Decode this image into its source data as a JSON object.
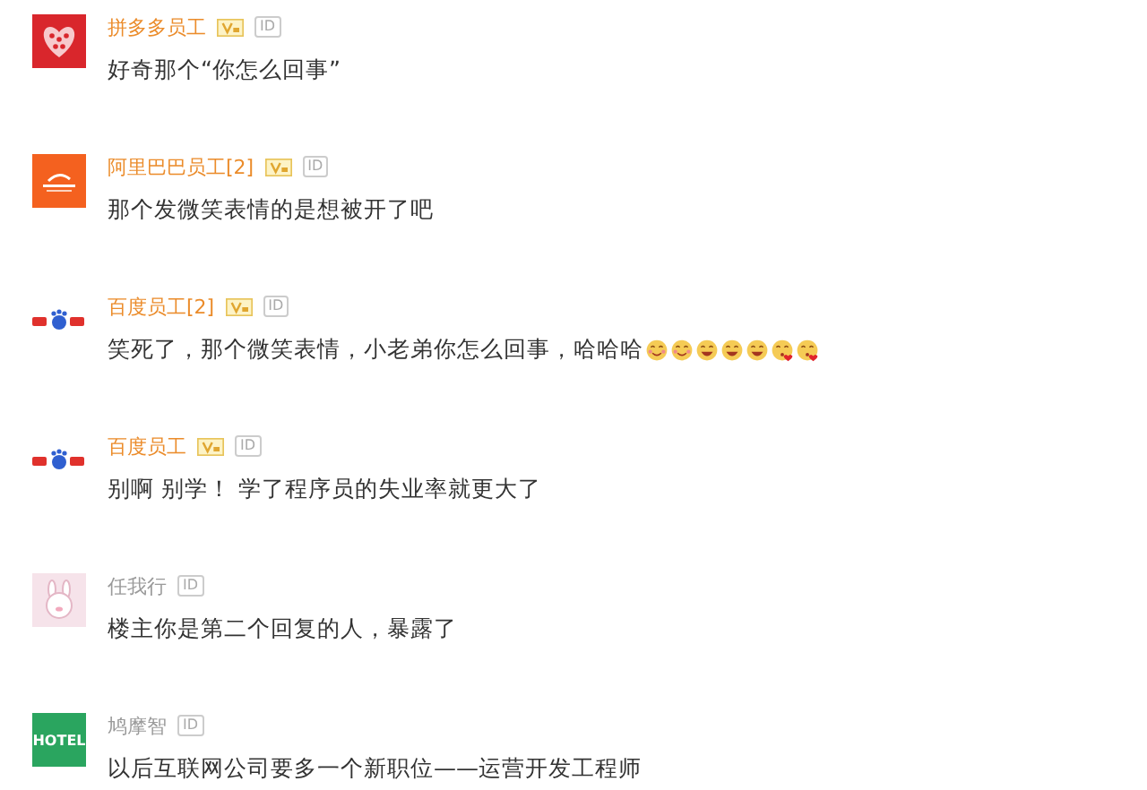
{
  "comments": [
    {
      "avatar": {
        "kind": "heart"
      },
      "name": "拼多多员工",
      "verified": true,
      "id_badge": "ID",
      "text": "好奇那个“你怎么回事”"
    },
    {
      "avatar": {
        "kind": "orange"
      },
      "name": "阿里巴巴员工[2]",
      "verified": true,
      "id_badge": "ID",
      "text": "那个发微笑表情的是想被开了吧"
    },
    {
      "avatar": {
        "kind": "paw"
      },
      "name": "百度员工[2]",
      "verified": true,
      "id_badge": "ID",
      "text": "笑死了，那个微笑表情，小老弟你怎么回事，哈哈哈",
      "emojis": [
        {
          "kind": "blush"
        },
        {
          "kind": "blush"
        },
        {
          "kind": "grin"
        },
        {
          "kind": "grin"
        },
        {
          "kind": "grin"
        },
        {
          "kind": "kiss"
        },
        {
          "kind": "kiss"
        }
      ]
    },
    {
      "avatar": {
        "kind": "paw"
      },
      "name": "百度员工",
      "verified": true,
      "id_badge": "ID",
      "text": "别啊 别学！ 学了程序员的失业率就更大了"
    },
    {
      "avatar": {
        "kind": "bunny"
      },
      "name": "任我行",
      "verified": false,
      "id_badge": "ID",
      "text": "楼主你是第二个回复的人，暴露了"
    },
    {
      "avatar": {
        "kind": "sign",
        "label": "HOTEL"
      },
      "name": "鸠摩智",
      "verified": false,
      "id_badge": "ID",
      "text": "以后互联网公司要多一个新职位——运营开发工程师"
    }
  ]
}
